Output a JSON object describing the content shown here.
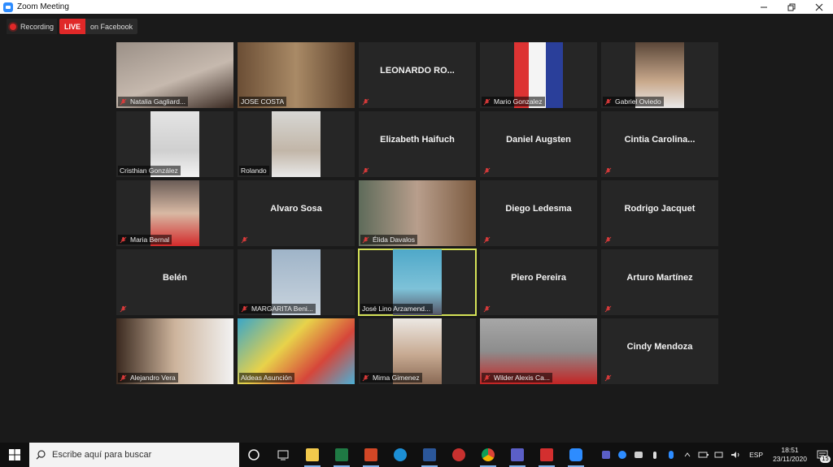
{
  "window": {
    "title": "Zoom Meeting"
  },
  "recording": {
    "label": "Recording"
  },
  "live": {
    "tag": "LIVE",
    "destination": "on Facebook"
  },
  "colors": {
    "accent_live": "#e02828",
    "active_speaker_border": "#d4e157",
    "muted_mic": "#e03b3b",
    "zoom_blue": "#2d8cff"
  },
  "participants": [
    {
      "name": "Natalia Gagliard...",
      "video": true,
      "muted": true
    },
    {
      "name": "JOSE COSTA",
      "video": true,
      "muted": false
    },
    {
      "name": "LEONARDO  RO...",
      "video": false,
      "muted": true
    },
    {
      "name": "Mario Gonzalez",
      "video": true,
      "muted": true
    },
    {
      "name": "Gabriel Oviedo",
      "video": true,
      "muted": true
    },
    {
      "name": "Cristhian González",
      "video": true,
      "muted": false
    },
    {
      "name": "Rolando",
      "video": true,
      "muted": false
    },
    {
      "name": "Elizabeth Haifuch",
      "video": false,
      "muted": true
    },
    {
      "name": "Daniel Augsten",
      "video": false,
      "muted": true
    },
    {
      "name": "Cintia  Carolina...",
      "video": false,
      "muted": true
    },
    {
      "name": "Maria Bernal",
      "video": true,
      "muted": true
    },
    {
      "name": "Alvaro Sosa",
      "video": false,
      "muted": true
    },
    {
      "name": "Élida Davalos",
      "video": true,
      "muted": true
    },
    {
      "name": "Diego Ledesma",
      "video": false,
      "muted": true
    },
    {
      "name": "Rodrigo Jacquet",
      "video": false,
      "muted": true
    },
    {
      "name": "Belén",
      "video": false,
      "muted": true
    },
    {
      "name": "MARGARITA Beni...",
      "video": true,
      "muted": true
    },
    {
      "name": "José Lino Arzamend...",
      "video": true,
      "muted": false,
      "active": true
    },
    {
      "name": "Piero Pereira",
      "video": false,
      "muted": true
    },
    {
      "name": "Arturo Martínez",
      "video": false,
      "muted": true
    },
    {
      "name": "Alejandro Vera",
      "video": true,
      "muted": true
    },
    {
      "name": "Aldeas Asunción",
      "video": true,
      "muted": false
    },
    {
      "name": "Mirna Gimenez",
      "video": true,
      "muted": true
    },
    {
      "name": "Wilder Alexis Ca...",
      "video": true,
      "muted": true
    },
    {
      "name": "Cindy Mendoza",
      "video": false,
      "muted": true
    }
  ],
  "taskbar": {
    "search_placeholder": "Escribe aquí para buscar",
    "apps": [
      "cortana-icon",
      "task-view-icon",
      "file-explorer-icon",
      "excel-icon",
      "powerpoint-icon",
      "edge-icon",
      "word-icon",
      "app-icon",
      "chrome-icon",
      "teams-icon",
      "acrobat-icon",
      "zoom-icon"
    ],
    "language": "ESP",
    "time": "18:51",
    "date": "23/11/2020",
    "notifications": "15"
  }
}
